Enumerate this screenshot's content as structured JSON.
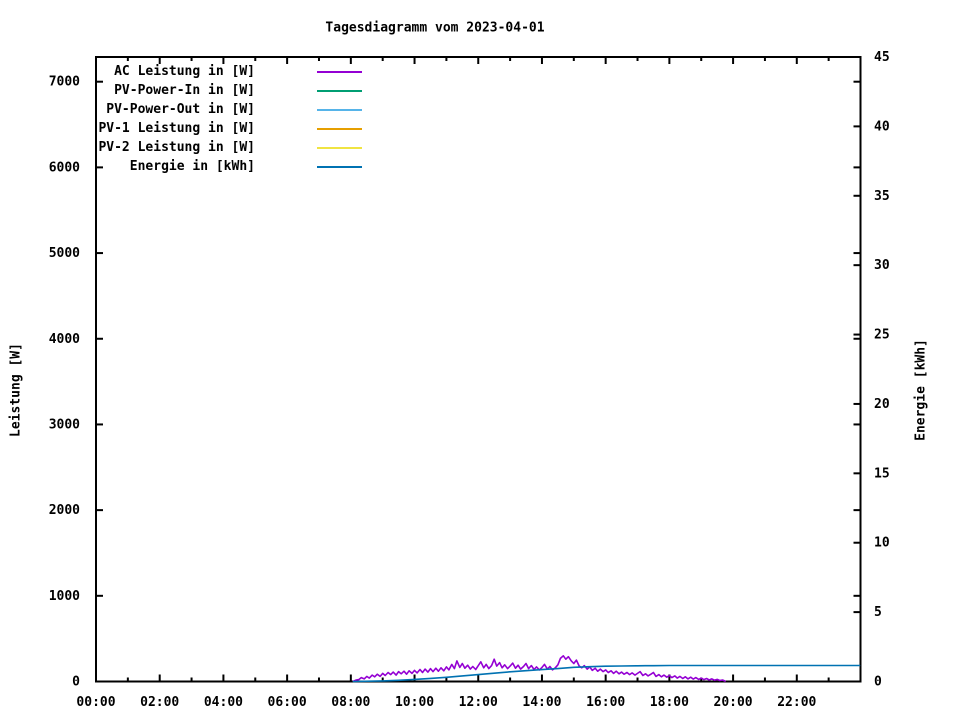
{
  "chart_data": {
    "type": "line",
    "title": "Tagesdiagramm vom 2023-04-01",
    "x_axis": {
      "unit": "time of day",
      "range_hours": [
        0,
        24
      ],
      "major_ticks": [
        {
          "hour": 0,
          "label": "00:00"
        },
        {
          "hour": 2,
          "label": "02:00"
        },
        {
          "hour": 4,
          "label": "04:00"
        },
        {
          "hour": 6,
          "label": "06:00"
        },
        {
          "hour": 8,
          "label": "08:00"
        },
        {
          "hour": 10,
          "label": "10:00"
        },
        {
          "hour": 12,
          "label": "12:00"
        },
        {
          "hour": 14,
          "label": "14:00"
        },
        {
          "hour": 16,
          "label": "16:00"
        },
        {
          "hour": 18,
          "label": "18:00"
        },
        {
          "hour": 20,
          "label": "20:00"
        },
        {
          "hour": 22,
          "label": "22:00"
        }
      ],
      "minor_tick_hours": [
        1,
        3,
        5,
        7,
        9,
        11,
        13,
        15,
        17,
        19,
        21,
        23
      ]
    },
    "y_left": {
      "label": "Leistung [W]",
      "range": [
        0,
        7300
      ],
      "ticks": [
        {
          "value": 0,
          "label": "0"
        },
        {
          "value": 1000,
          "label": "1000"
        },
        {
          "value": 2000,
          "label": "2000"
        },
        {
          "value": 3000,
          "label": "3000"
        },
        {
          "value": 4000,
          "label": "4000"
        },
        {
          "value": 5000,
          "label": "5000"
        },
        {
          "value": 6000,
          "label": "6000"
        },
        {
          "value": 7000,
          "label": "7000"
        }
      ]
    },
    "y_right": {
      "label": "Energie [kWh]",
      "range": [
        0,
        45
      ],
      "ticks": [
        {
          "value": 0,
          "label": "0"
        },
        {
          "value": 5,
          "label": "5"
        },
        {
          "value": 10,
          "label": "10"
        },
        {
          "value": 15,
          "label": "15"
        },
        {
          "value": 20,
          "label": "20"
        },
        {
          "value": 25,
          "label": "25"
        },
        {
          "value": 30,
          "label": "30"
        },
        {
          "value": 35,
          "label": "35"
        },
        {
          "value": 40,
          "label": "40"
        },
        {
          "value": 45,
          "label": "45"
        }
      ]
    },
    "legend": [
      {
        "label": "AC Leistung in [W]",
        "color": "#9400d3"
      },
      {
        "label": "PV-Power-In in [W]",
        "color": "#009e73"
      },
      {
        "label": "PV-Power-Out in [W]",
        "color": "#56b4e9"
      },
      {
        "label": "PV-1 Leistung in [W]",
        "color": "#e69f00"
      },
      {
        "label": "PV-2 Leistung in [W]",
        "color": "#f0e442"
      },
      {
        "label": "Energie in [kWh]",
        "color": "#0072b2"
      }
    ],
    "series": [
      {
        "name": "AC Leistung in [W]",
        "axis": "left",
        "color": "#9400d3",
        "points": [
          [
            8.08,
            4
          ],
          [
            8.17,
            18
          ],
          [
            8.25,
            22
          ],
          [
            8.33,
            45
          ],
          [
            8.42,
            30
          ],
          [
            8.5,
            60
          ],
          [
            8.58,
            40
          ],
          [
            8.67,
            75
          ],
          [
            8.75,
            55
          ],
          [
            8.83,
            85
          ],
          [
            8.92,
            60
          ],
          [
            9.0,
            95
          ],
          [
            9.08,
            70
          ],
          [
            9.17,
            105
          ],
          [
            9.25,
            80
          ],
          [
            9.33,
            110
          ],
          [
            9.42,
            75
          ],
          [
            9.5,
            115
          ],
          [
            9.58,
            90
          ],
          [
            9.67,
            120
          ],
          [
            9.75,
            85
          ],
          [
            9.83,
            125
          ],
          [
            9.92,
            95
          ],
          [
            10.0,
            130
          ],
          [
            10.08,
            100
          ],
          [
            10.17,
            140
          ],
          [
            10.25,
            105
          ],
          [
            10.33,
            145
          ],
          [
            10.42,
            110
          ],
          [
            10.5,
            150
          ],
          [
            10.58,
            115
          ],
          [
            10.67,
            155
          ],
          [
            10.75,
            120
          ],
          [
            10.83,
            160
          ],
          [
            10.92,
            125
          ],
          [
            11.0,
            170
          ],
          [
            11.08,
            135
          ],
          [
            11.17,
            200
          ],
          [
            11.25,
            150
          ],
          [
            11.33,
            240
          ],
          [
            11.42,
            165
          ],
          [
            11.5,
            210
          ],
          [
            11.58,
            155
          ],
          [
            11.67,
            190
          ],
          [
            11.75,
            145
          ],
          [
            11.83,
            175
          ],
          [
            11.92,
            140
          ],
          [
            12.0,
            185
          ],
          [
            12.08,
            230
          ],
          [
            12.17,
            160
          ],
          [
            12.25,
            200
          ],
          [
            12.33,
            150
          ],
          [
            12.42,
            185
          ],
          [
            12.5,
            260
          ],
          [
            12.58,
            180
          ],
          [
            12.67,
            220
          ],
          [
            12.75,
            160
          ],
          [
            12.83,
            195
          ],
          [
            12.92,
            150
          ],
          [
            13.0,
            180
          ],
          [
            13.08,
            215
          ],
          [
            13.17,
            155
          ],
          [
            13.25,
            190
          ],
          [
            13.33,
            145
          ],
          [
            13.42,
            175
          ],
          [
            13.5,
            210
          ],
          [
            13.58,
            150
          ],
          [
            13.67,
            185
          ],
          [
            13.75,
            140
          ],
          [
            13.83,
            170
          ],
          [
            13.92,
            135
          ],
          [
            14.0,
            165
          ],
          [
            14.08,
            200
          ],
          [
            14.17,
            145
          ],
          [
            14.25,
            175
          ],
          [
            14.33,
            135
          ],
          [
            14.42,
            160
          ],
          [
            14.5,
            195
          ],
          [
            14.58,
            270
          ],
          [
            14.67,
            300
          ],
          [
            14.75,
            260
          ],
          [
            14.83,
            290
          ],
          [
            14.92,
            240
          ],
          [
            15.0,
            210
          ],
          [
            15.08,
            250
          ],
          [
            15.17,
            180
          ],
          [
            15.25,
            160
          ],
          [
            15.33,
            185
          ],
          [
            15.42,
            145
          ],
          [
            15.5,
            170
          ],
          [
            15.58,
            130
          ],
          [
            15.67,
            155
          ],
          [
            15.75,
            120
          ],
          [
            15.83,
            145
          ],
          [
            15.92,
            115
          ],
          [
            16.0,
            135
          ],
          [
            16.08,
            105
          ],
          [
            16.17,
            125
          ],
          [
            16.25,
            95
          ],
          [
            16.33,
            120
          ],
          [
            16.42,
            90
          ],
          [
            16.5,
            110
          ],
          [
            16.58,
            85
          ],
          [
            16.67,
            105
          ],
          [
            16.75,
            80
          ],
          [
            16.83,
            100
          ],
          [
            16.92,
            75
          ],
          [
            17.0,
            95
          ],
          [
            17.08,
            115
          ],
          [
            17.17,
            70
          ],
          [
            17.25,
            90
          ],
          [
            17.33,
            65
          ],
          [
            17.42,
            85
          ],
          [
            17.5,
            105
          ],
          [
            17.58,
            60
          ],
          [
            17.67,
            80
          ],
          [
            17.75,
            55
          ],
          [
            17.83,
            75
          ],
          [
            17.92,
            50
          ],
          [
            18.0,
            70
          ],
          [
            18.08,
            45
          ],
          [
            18.17,
            65
          ],
          [
            18.25,
            40
          ],
          [
            18.33,
            60
          ],
          [
            18.42,
            35
          ],
          [
            18.5,
            55
          ],
          [
            18.58,
            30
          ],
          [
            18.67,
            50
          ],
          [
            18.75,
            28
          ],
          [
            18.83,
            45
          ],
          [
            18.92,
            25
          ],
          [
            19.0,
            40
          ],
          [
            19.08,
            22
          ],
          [
            19.17,
            35
          ],
          [
            19.25,
            18
          ],
          [
            19.33,
            30
          ],
          [
            19.42,
            15
          ],
          [
            19.5,
            25
          ],
          [
            19.58,
            12
          ],
          [
            19.67,
            18
          ],
          [
            19.75,
            5
          ]
        ]
      },
      {
        "name": "PV-Power-In in [W]",
        "axis": "left",
        "color": "#009e73",
        "points": []
      },
      {
        "name": "PV-Power-Out in [W]",
        "axis": "left",
        "color": "#56b4e9",
        "points": []
      },
      {
        "name": "PV-1 Leistung in [W]",
        "axis": "left",
        "color": "#e69f00",
        "points": []
      },
      {
        "name": "PV-2 Leistung in [W]",
        "axis": "left",
        "color": "#f0e442",
        "points": []
      },
      {
        "name": "Energie in [kWh]",
        "axis": "right",
        "color": "#0072b2",
        "points": [
          [
            8.08,
            0
          ],
          [
            9.0,
            0.04
          ],
          [
            9.5,
            0.09
          ],
          [
            10.0,
            0.15
          ],
          [
            10.5,
            0.22
          ],
          [
            11.0,
            0.3
          ],
          [
            11.5,
            0.4
          ],
          [
            12.0,
            0.5
          ],
          [
            12.5,
            0.6
          ],
          [
            13.0,
            0.7
          ],
          [
            13.5,
            0.78
          ],
          [
            14.0,
            0.86
          ],
          [
            14.5,
            0.93
          ],
          [
            15.0,
            1.02
          ],
          [
            15.5,
            1.07
          ],
          [
            16.0,
            1.1
          ],
          [
            16.5,
            1.12
          ],
          [
            17.0,
            1.13
          ],
          [
            17.25,
            1.14
          ],
          [
            17.5,
            1.14
          ],
          [
            18.0,
            1.15
          ],
          [
            19.0,
            1.15
          ],
          [
            20.0,
            1.15
          ],
          [
            21.0,
            1.15
          ],
          [
            22.0,
            1.15
          ],
          [
            23.0,
            1.15
          ],
          [
            23.97,
            1.15
          ]
        ]
      }
    ],
    "layout": {
      "grid": false,
      "legend_position": "top-left-inside",
      "axis_color": "#000000",
      "background": "#ffffff"
    }
  }
}
